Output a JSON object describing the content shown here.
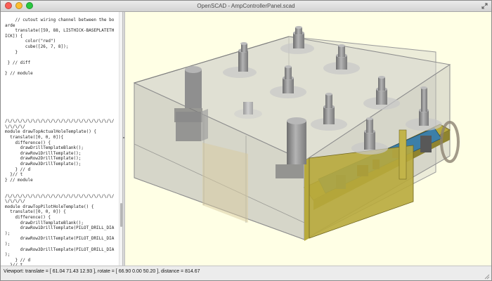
{
  "window": {
    "title": "OpenSCAD - AmpControllerPanel.scad"
  },
  "editor": {
    "code": "    // cutout wiring channel between the bo\narde\n    translate([59, 88, LISTHICK-BASEPLATETH\nICK]) {\n        color(\"red\")\n        cube([26, 7, 8]);\n    }\n\n } // diff\n\n} // module\n\n\n\n\n\n\n\n\n/\\/\\/\\/\\/\\/\\/\\/\\/\\/\\/\\/\\/\\/\\/\\/\\/\\/\\/\\/\\/\\/\n\\/\\/\\/\\/\nmodule drawTopActualHoleTemplate() {\n  translate([0, 0, 0]){\n    difference() {\n      drawDrillTemplateBlank();\n      drawRow1DrillTemplate();\n      drawRow2DrillTemplate();\n      drawRow3DrillTemplate();\n    } // d\n  }// t\n} // module\n\n\n/\\/\\/\\/\\/\\/\\/\\/\\/\\/\\/\\/\\/\\/\\/\\/\\/\\/\\/\\/\\/\\/\n\\/\\/\\/\\/\nmodule drawTopPilotHoleTemplate() {\n  translate([0, 0, 0]) {\n    difference() {\n      drawDrillTemplateBlank();\n      drawRow1DrillTemplate(PILOT_DRILL_DIA\n);\n      drawRow2DrillTemplate(PILOT_DRILL_DIA\n);\n      drawRow3DrillTemplate(PILOT_DRILL_DIA\n);\n    } // d\n  }// t\n} // module"
  },
  "statusbar": {
    "text": "Viewport: translate = [ 61.04 71.43 12.93 ], rotate = [ 66.90 0.00 50.20 ], distance = 814.67"
  },
  "colors": {
    "viewport_background": "#ffffe5",
    "box_shell": "#c8c8c8",
    "knob": "#8f8f8f",
    "pcb": "#3c7fa8",
    "mount_plate": "#b8aa3c"
  },
  "icons": [
    "close-light",
    "minimize-light",
    "zoom-light",
    "fullscreen-icon",
    "resize-grip-icon"
  ]
}
